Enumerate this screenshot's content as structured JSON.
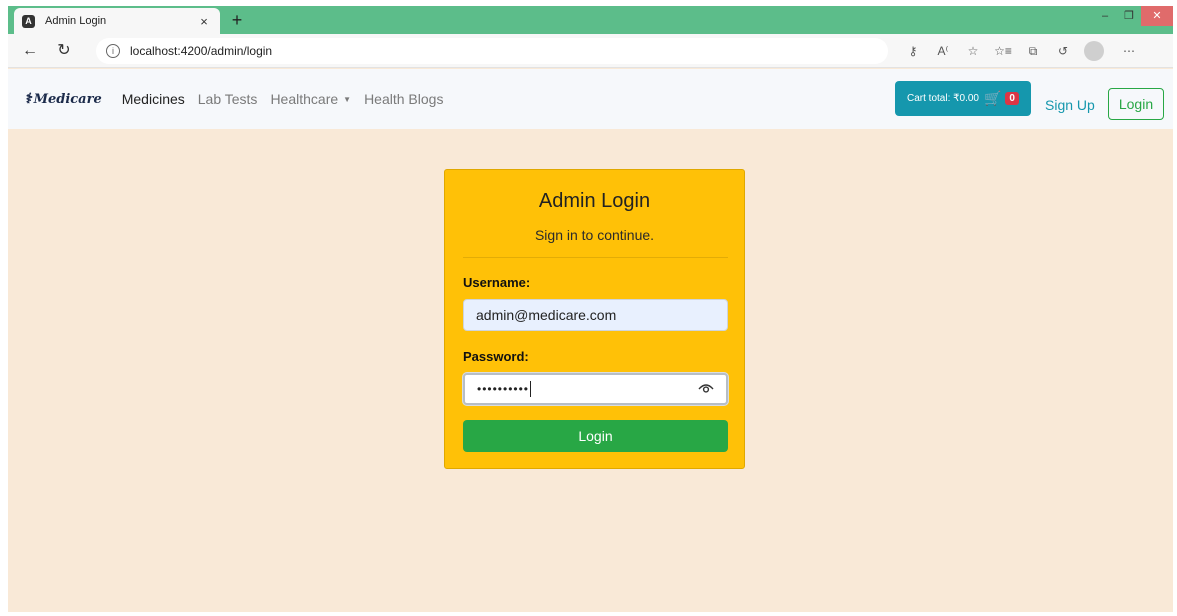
{
  "browser": {
    "tab_title": "Admin Login",
    "tab_close": "×",
    "new_tab": "+",
    "url": "localhost:4200/admin/login"
  },
  "navbar": {
    "brand": "Medicare",
    "links": [
      "Medicines",
      "Lab Tests",
      "Healthcare",
      "Health Blogs"
    ],
    "cart_label": "Cart total: ₹0.00",
    "cart_count": "0",
    "signup": "Sign Up",
    "login": "Login"
  },
  "login_card": {
    "title": "Admin Login",
    "subtitle": "Sign in to continue.",
    "username_label": "Username:",
    "username_value": "admin@medicare.com",
    "password_label": "Password:",
    "password_value": "••••••••••",
    "submit": "Login"
  },
  "colors": {
    "page_bg": "#f9e9d7",
    "card_bg": "#ffc107",
    "success": "#28a745",
    "info": "#1597ad",
    "danger": "#dc3545",
    "tabstrip": "#5cbd8a"
  },
  "icons": [
    "angular-favicon-icon",
    "back-icon",
    "reload-icon",
    "info-icon",
    "cart-icon",
    "eye-icon"
  ]
}
